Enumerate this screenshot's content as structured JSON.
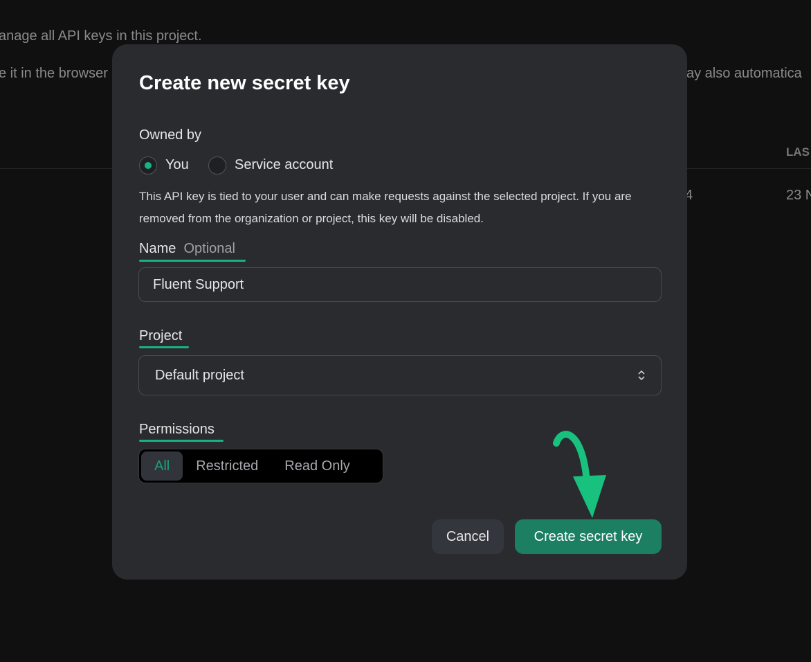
{
  "background": {
    "line1": "anage all API keys in this project.",
    "line2_left": "e it in the browser",
    "line2_right": "ay also automatica",
    "col_header": "LAS",
    "row_cell1": "4",
    "row_cell2": "23 N"
  },
  "modal": {
    "title": "Create new secret key",
    "owned_by": {
      "label": "Owned by",
      "options": [
        {
          "label": "You",
          "selected": true
        },
        {
          "label": "Service account",
          "selected": false
        }
      ],
      "description": "This API key is tied to your user and can make requests against the selected project. If you are removed from the organization or project, this key will be disabled."
    },
    "name": {
      "label": "Name",
      "optional": "Optional",
      "value": "Fluent Support"
    },
    "project": {
      "label": "Project",
      "value": "Default project"
    },
    "permissions": {
      "label": "Permissions",
      "options": [
        "All",
        "Restricted",
        "Read Only"
      ],
      "selected": "All"
    },
    "cancel_label": "Cancel",
    "submit_label": "Create secret key"
  },
  "colors": {
    "accent": "#19b37d",
    "button": "#1c7f62",
    "annotation_arrow": "#19c17f"
  },
  "icons": {
    "select": "chevron-up-down-icon",
    "annotation": "curved-arrow-icon"
  }
}
